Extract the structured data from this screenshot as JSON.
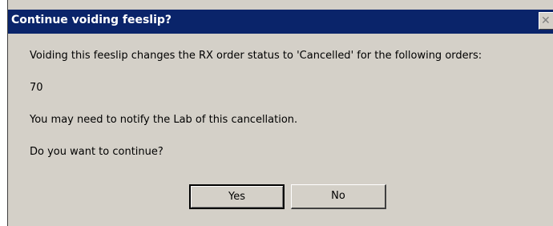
{
  "dialog": {
    "title": "Continue voiding feeslip?",
    "close_symbol": "✕",
    "message_line1": "Voiding this feeslip changes the RX order status to 'Cancelled' for the following orders:",
    "order_list": "70",
    "message_line2": "You may need to notify the Lab of this cancellation.",
    "question": "Do you want to continue?",
    "yes_label": "Yes",
    "no_label": "No"
  },
  "colors": {
    "titlebar": "#0a246a",
    "dialog_bg": "#d4d0c8",
    "title_text": "#ffffff"
  }
}
